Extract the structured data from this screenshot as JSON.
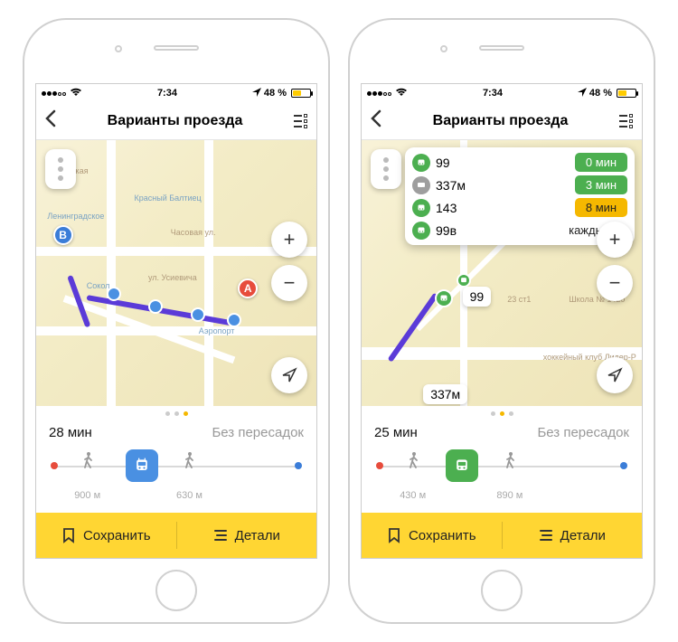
{
  "status": {
    "time": "7:34",
    "battery_pct": "48 %"
  },
  "nav": {
    "title": "Варианты проезда"
  },
  "left": {
    "summary": {
      "duration": "28 мин",
      "transfers": "Без пересадок"
    },
    "legs": {
      "walk1": "900 м",
      "walk2": "630 м"
    },
    "markers": {
      "a": "A",
      "b": "B"
    },
    "map_labels": {
      "sokol": "Сокол",
      "aeroport": "Аэропорт",
      "baltiyets": "Красный Балтиец",
      "leningradka": "Ленинградское",
      "voykovskaya": "Войковская",
      "usievcha": "ул. Усиевича",
      "chasovaya": "Часовая ул."
    }
  },
  "right": {
    "summary": {
      "duration": "25 мин",
      "transfers": "Без пересадок"
    },
    "legs": {
      "walk1": "430 м",
      "walk2": "890 м"
    },
    "popup": [
      {
        "route": "99",
        "icon": "green",
        "badge_text": "0 мин",
        "badge_class": "green"
      },
      {
        "route": "337м",
        "icon": "gray",
        "badge_text": "3 мин",
        "badge_class": "green"
      },
      {
        "route": "143",
        "icon": "green",
        "badge_text": "8 мин",
        "badge_class": "amber"
      },
      {
        "route": "99в",
        "icon": "green",
        "badge_text": "каждые 9",
        "badge_class": "plain"
      }
    ],
    "map_label_route": "99",
    "map_label_dist": "337м",
    "map_labels": {
      "school": "Школа № 1420",
      "lider": "хоккейный клуб Лидер-Р",
      "col": "23 ст1"
    }
  },
  "actions": {
    "save": "Сохранить",
    "details": "Детали"
  }
}
